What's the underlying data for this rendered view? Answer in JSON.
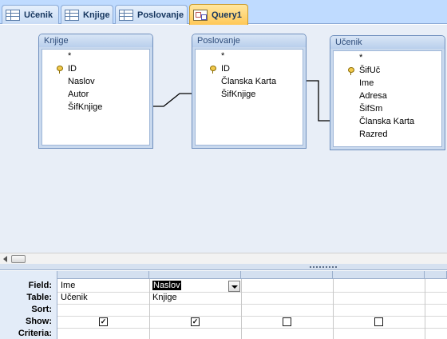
{
  "tabs": [
    {
      "label": "Učenik",
      "icon": "table-icon"
    },
    {
      "label": "Knjige",
      "icon": "table-icon"
    },
    {
      "label": "Poslovanje",
      "icon": "table-icon"
    },
    {
      "label": "Query1",
      "icon": "query-icon",
      "active": true
    }
  ],
  "tables": [
    {
      "title": "Knjige",
      "fields": [
        "*",
        "ID",
        "Naslov",
        "Autor",
        "ŠifKnjige"
      ],
      "key_field": "ID"
    },
    {
      "title": "Poslovanje",
      "fields": [
        "*",
        "ID",
        "Članska Karta",
        "ŠifKnjige"
      ],
      "key_field": "ID"
    },
    {
      "title": "Učenik",
      "fields": [
        "*",
        "ŠifUč",
        "Ime",
        "Adresa",
        "ŠifSm",
        "Članska Karta",
        "Razred"
      ],
      "key_field": "ŠifUč"
    }
  ],
  "grid": {
    "row_labels": [
      "Field:",
      "Table:",
      "Sort:",
      "Show:",
      "Criteria:"
    ],
    "columns": [
      {
        "field": "Ime",
        "table": "Učenik",
        "show": true
      },
      {
        "field": "Naslov",
        "table": "Knjige",
        "show": true,
        "selected": true
      },
      {
        "field": "",
        "table": "",
        "show": false
      },
      {
        "field": "",
        "table": "",
        "show": false
      }
    ]
  },
  "colors": {
    "active_tab": "#ffc857",
    "design_bg": "#e8eef7",
    "tab_strip": "#bfdbff"
  }
}
